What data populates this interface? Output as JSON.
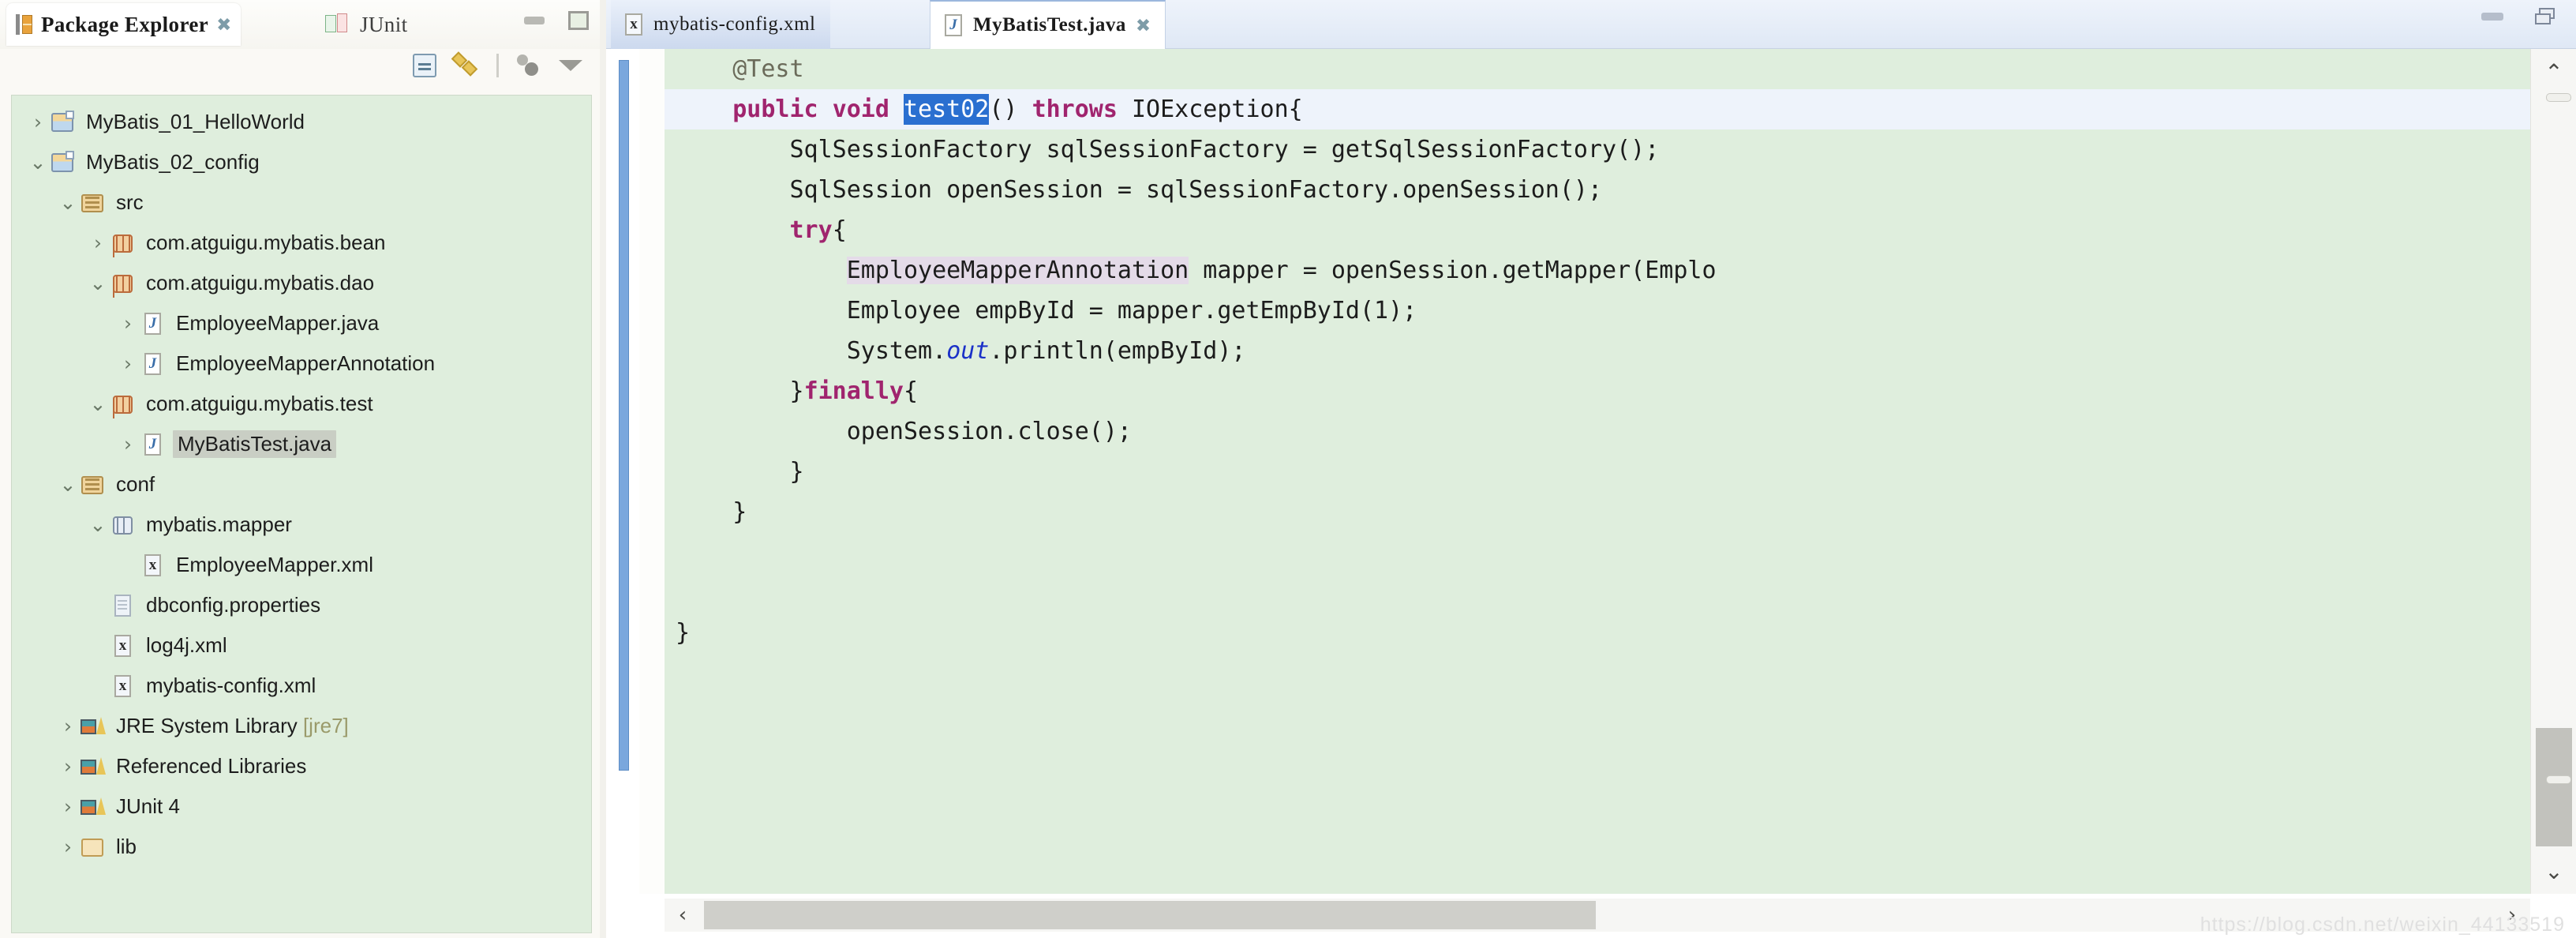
{
  "explorer": {
    "tabs": [
      {
        "label": "Package Explorer",
        "icon": "package-explorer-icon",
        "active": true,
        "closable": true
      },
      {
        "label": "JUnit",
        "icon": "junit-icon",
        "active": false,
        "closable": false
      }
    ],
    "window_controls": [
      {
        "name": "minimize",
        "label": ""
      },
      {
        "name": "maximize",
        "label": ""
      }
    ],
    "toolbar": [
      {
        "name": "collapse-all",
        "label": ""
      },
      {
        "name": "link-with-editor",
        "label": ""
      },
      {
        "name": "separator",
        "label": ""
      },
      {
        "name": "view-menu-dots",
        "label": ""
      },
      {
        "name": "view-menu-caret",
        "label": ""
      }
    ],
    "tree": [
      {
        "label": "MyBatis_01_HelloWorld",
        "icon": "project-icon",
        "indent": 0,
        "state": "collapsed",
        "selected": false
      },
      {
        "label": "MyBatis_02_config",
        "icon": "project-icon",
        "indent": 0,
        "state": "expanded",
        "selected": false
      },
      {
        "label": "src",
        "icon": "source-folder-icon",
        "indent": 1,
        "state": "expanded",
        "selected": false
      },
      {
        "label": "com.atguigu.mybatis.bean",
        "icon": "package-icon",
        "indent": 2,
        "state": "collapsed",
        "selected": false
      },
      {
        "label": "com.atguigu.mybatis.dao",
        "icon": "package-icon",
        "indent": 2,
        "state": "expanded",
        "selected": false
      },
      {
        "label": "EmployeeMapper.java",
        "icon": "java-file-icon",
        "indent": 3,
        "state": "collapsed",
        "selected": false
      },
      {
        "label": "EmployeeMapperAnnotation",
        "icon": "java-file-icon",
        "indent": 3,
        "state": "collapsed",
        "selected": false
      },
      {
        "label": "com.atguigu.mybatis.test",
        "icon": "package-icon",
        "indent": 2,
        "state": "expanded",
        "selected": false
      },
      {
        "label": "MyBatisTest.java",
        "icon": "java-file-icon",
        "indent": 3,
        "state": "collapsed",
        "selected": true
      },
      {
        "label": "conf",
        "icon": "source-folder-icon",
        "indent": 1,
        "state": "expanded",
        "selected": false
      },
      {
        "label": "mybatis.mapper",
        "icon": "plain-package-icon",
        "indent": 2,
        "state": "expanded",
        "selected": false
      },
      {
        "label": "EmployeeMapper.xml",
        "icon": "xml-file-icon",
        "indent": 3,
        "state": "leaf",
        "selected": false
      },
      {
        "label": "dbconfig.properties",
        "icon": "properties-file-icon",
        "indent": 2,
        "state": "leaf",
        "selected": false
      },
      {
        "label": "log4j.xml",
        "icon": "xml-file-icon",
        "indent": 2,
        "state": "leaf",
        "selected": false
      },
      {
        "label": "mybatis-config.xml",
        "icon": "xml-file-icon",
        "indent": 2,
        "state": "leaf",
        "selected": false
      },
      {
        "label": "JRE System Library",
        "sub": "[jre7]",
        "icon": "library-icon",
        "indent": 1,
        "state": "collapsed",
        "selected": false
      },
      {
        "label": "Referenced Libraries",
        "icon": "library-icon",
        "indent": 1,
        "state": "collapsed",
        "selected": false
      },
      {
        "label": "JUnit 4",
        "icon": "library-icon",
        "indent": 1,
        "state": "collapsed",
        "selected": false
      },
      {
        "label": "lib",
        "icon": "lib-folder-icon",
        "indent": 1,
        "state": "collapsed",
        "selected": false
      }
    ]
  },
  "editor": {
    "tabs": [
      {
        "label": "mybatis-config.xml",
        "icon": "xml-file-icon",
        "active": false,
        "closable": false
      },
      {
        "label": "MyBatisTest.java",
        "icon": "java-file-icon",
        "active": true,
        "closable": true
      }
    ],
    "window_controls": [
      {
        "name": "minimize",
        "label": ""
      },
      {
        "name": "restore",
        "label": ""
      }
    ],
    "selection": "test02",
    "current_line_index": 1,
    "code_lines": [
      {
        "indent": 1,
        "segments": [
          {
            "t": "@Test",
            "c": "annotation"
          }
        ]
      },
      {
        "indent": 1,
        "segments": [
          {
            "t": "public",
            "c": "keyword"
          },
          {
            "t": " "
          },
          {
            "t": "void",
            "c": "keyword"
          },
          {
            "t": " "
          },
          {
            "t": "test02",
            "c": "selected"
          },
          {
            "t": "() "
          },
          {
            "t": "throws",
            "c": "keyword"
          },
          {
            "t": " IOException{"
          }
        ]
      },
      {
        "indent": 2,
        "segments": [
          {
            "t": "SqlSessionFactory sqlSessionFactory = getSqlSessionFactory();"
          }
        ]
      },
      {
        "indent": 2,
        "segments": [
          {
            "t": "SqlSession openSession = sqlSessionFactory.openSession();"
          }
        ]
      },
      {
        "indent": 2,
        "segments": [
          {
            "t": "try",
            "c": "keyword"
          },
          {
            "t": "{"
          }
        ]
      },
      {
        "indent": 3,
        "segments": [
          {
            "t": "EmployeeMapperAnnotation",
            "c": "occurrence"
          },
          {
            "t": " mapper = openSession.getMapper(Emplo"
          }
        ]
      },
      {
        "indent": 3,
        "segments": [
          {
            "t": "Employee empById = mapper.getEmpById(1);"
          }
        ]
      },
      {
        "indent": 3,
        "segments": [
          {
            "t": "System."
          },
          {
            "t": "out",
            "c": "static-field"
          },
          {
            "t": ".println(empById);"
          }
        ]
      },
      {
        "indent": 2,
        "segments": [
          {
            "t": "}"
          },
          {
            "t": "finally",
            "c": "keyword"
          },
          {
            "t": "{"
          }
        ]
      },
      {
        "indent": 3,
        "segments": [
          {
            "t": "openSession.close();"
          }
        ]
      },
      {
        "indent": 2,
        "segments": [
          {
            "t": "}"
          }
        ]
      },
      {
        "indent": 1,
        "segments": [
          {
            "t": "}"
          }
        ]
      },
      {
        "indent": 0,
        "segments": []
      },
      {
        "indent": 0,
        "segments": []
      },
      {
        "indent": 0,
        "segments": [
          {
            "t": "}"
          }
        ]
      }
    ],
    "vertical_scrollbar": {
      "up_arrow": "⌃",
      "down_arrow": "⌄"
    },
    "horizontal_scrollbar": {
      "left_arrow": "‹",
      "right_arrow": "›"
    }
  },
  "watermark": "https://blog.csdn.net/weixin_44133519",
  "colors": {
    "editor_background": "#dfeedd",
    "current_line": "#eef3fb",
    "selection": "#2a6fd0",
    "keyword": "#a0246e",
    "static_field": "#1b31c8",
    "annotation": "#6b6b5a",
    "occurrence_highlight": "#e4dbe8",
    "tree_background": "#dfeedd",
    "tree_selection": "#c9cec4",
    "change_bar": "#7aa7dd"
  }
}
